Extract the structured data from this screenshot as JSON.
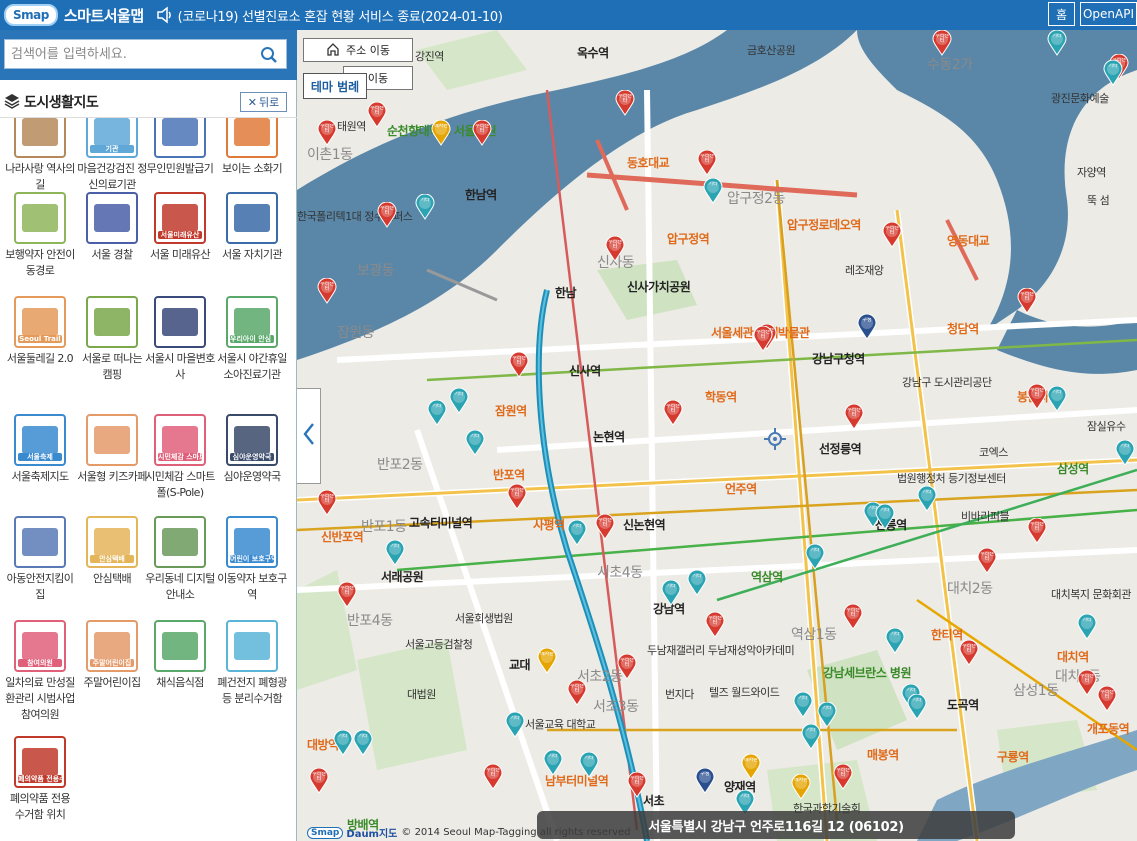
{
  "header": {
    "logo_badge": "Smap",
    "app_title": "스마트서울맵",
    "notice": "(코로나19) 선별진료소 혼잡 현황 서비스 종료(2024-01-10)",
    "btn_home": "홈",
    "btn_map": "지도",
    "btn_api": "OpenAPI"
  },
  "search": {
    "placeholder": "검색어를 입력하세요."
  },
  "panel": {
    "title": "도시생활지도",
    "back_label": "뒤로"
  },
  "items": [
    {
      "label": "나라사랑 역사의 길",
      "icon": "history-road-icon",
      "color": "#b5895a",
      "badge": ""
    },
    {
      "label": "마음건강검진 정신의료기관",
      "icon": "mental-health-icon",
      "color": "#5fa8d8",
      "badge": "기관"
    },
    {
      "label": "무인민원발급기",
      "icon": "kiosk-icon",
      "color": "#4a74b5",
      "badge": ""
    },
    {
      "label": "보이는 소화기",
      "icon": "extinguisher-icon",
      "color": "#e07a3a",
      "badge": ""
    },
    {
      "label": "보행약자 안전이동경로",
      "icon": "safe-route-icon",
      "color": "#8fb55a",
      "badge": ""
    },
    {
      "label": "서울 경찰",
      "icon": "police-icon",
      "color": "#4a5fa8",
      "badge": ""
    },
    {
      "label": "서울 미래유산",
      "icon": "future-heritage-icon",
      "color": "#c0392b",
      "badge": "서울미래유산"
    },
    {
      "label": "서울 자치기관",
      "icon": "government-office-icon",
      "color": "#3a6aa8",
      "badge": ""
    },
    {
      "label": "서울둘레길 2.0",
      "icon": "trail-icon",
      "color": "#e59a5a",
      "badge": "Seoul Trail"
    },
    {
      "label": "서울로 떠나는 캠핑",
      "icon": "camping-icon",
      "color": "#7aa84a",
      "badge": ""
    },
    {
      "label": "서울시 마을변호사",
      "icon": "lawyer-icon",
      "color": "#3a4a7a",
      "badge": ""
    },
    {
      "label": "서울시 야간휴일 소아진료기관",
      "icon": "pediatric-icon",
      "color": "#5aa86a",
      "badge": "우리아이 안심 의료기관"
    },
    {
      "label": "서울축제지도",
      "icon": "festival-icon",
      "color": "#3a8ad0",
      "badge": "서울축제"
    },
    {
      "label": "서울형 키즈카페",
      "icon": "kids-cafe-icon",
      "color": "#e59a6a",
      "badge": ""
    },
    {
      "label": "시민체감 스마트폴(S-Pole)",
      "icon": "smart-pole-icon",
      "color": "#e0607a",
      "badge": "시민체감 스마트폴"
    },
    {
      "label": "심야운영약국",
      "icon": "night-pharmacy-icon",
      "color": "#3a4a6a",
      "badge": "심야운영약국"
    },
    {
      "label": "아동안전지킴이집",
      "icon": "child-safety-icon",
      "color": "#5a7ab5",
      "badge": ""
    },
    {
      "label": "안심택배",
      "icon": "parcel-icon",
      "color": "#e5b55a",
      "badge": "안심택배"
    },
    {
      "label": "우리동네 디지털안내소",
      "icon": "digital-guide-icon",
      "color": "#6a9a5a",
      "badge": ""
    },
    {
      "label": "이동약자 보호구역",
      "icon": "mobility-zone-icon",
      "color": "#3a8ad0",
      "badge": "어린이 보호구역"
    },
    {
      "label": "일차의료 만성질환관리 시범사업 참여의원",
      "icon": "clinic-icon",
      "color": "#e0607a",
      "badge": "참여의원"
    },
    {
      "label": "주말어린이집",
      "icon": "weekend-daycare-icon",
      "color": "#e59a6a",
      "badge": "주말어린이집"
    },
    {
      "label": "채식음식점",
      "icon": "vegetarian-icon",
      "color": "#5aa86a",
      "badge": ""
    },
    {
      "label": "폐건전지 폐형광등 분리수거함",
      "icon": "battery-recycle-icon",
      "color": "#5ab5d8",
      "badge": ""
    },
    {
      "label": "폐의약품 전용 수거함 위치",
      "icon": "medicine-disposal-icon",
      "color": "#c0392b",
      "badge": "폐의약품 전용수거함"
    }
  ],
  "map": {
    "btn_address_move": "주소 이동",
    "btn_theme": "테마 범례",
    "btn_behind": "이동",
    "address": "서울특별시 강남구 언주로116길 12 (06102)",
    "copyright": "© 2014 Seoul Map-Tagging all rights reserved",
    "copyright_logo": "Smap",
    "daum_logo": "Daum지도",
    "pin_label_red": "우리센터",
    "pin_label_teal": "기타",
    "pin_label_yellow": "메자판",
    "pin_label_navy": "구청",
    "places": [
      {
        "t": "강진역",
        "c": "s"
      },
      {
        "t": "옥수역",
        "c": ""
      },
      {
        "t": "금호산공원",
        "c": "s"
      },
      {
        "t": "수동2가",
        "c": "gr"
      },
      {
        "t": "광진문화예술",
        "c": "s"
      },
      {
        "t": "태원역",
        "c": "s"
      },
      {
        "t": "순천향대학교 서울병원",
        "c": "g"
      },
      {
        "t": "한남역",
        "c": ""
      },
      {
        "t": "동호대교",
        "c": "o"
      },
      {
        "t": "압구정2동",
        "c": "gr"
      },
      {
        "t": "자양역",
        "c": "s"
      },
      {
        "t": "뚝 섬",
        "c": "s"
      },
      {
        "t": "한국폴리텍1대 정수캠퍼스",
        "c": "s"
      },
      {
        "t": "압구정로데오역",
        "c": "o"
      },
      {
        "t": "압구정역",
        "c": "o"
      },
      {
        "t": "영동대교",
        "c": "o"
      },
      {
        "t": "레조재앙",
        "c": "s"
      },
      {
        "t": "신사가치공원",
        "c": ""
      },
      {
        "t": "한남",
        "c": ""
      },
      {
        "t": "청담역",
        "c": "o"
      },
      {
        "t": "서울세관 관세박물관",
        "c": "o"
      },
      {
        "t": "강남구청역",
        "c": ""
      },
      {
        "t": "신사역",
        "c": ""
      },
      {
        "t": "학동역",
        "c": "o"
      },
      {
        "t": "강남구 도시관리공단",
        "c": "s"
      },
      {
        "t": "봉은사역",
        "c": "o"
      },
      {
        "t": "잠실유수",
        "c": "s"
      },
      {
        "t": "잠원역",
        "c": "o"
      },
      {
        "t": "논현역",
        "c": ""
      },
      {
        "t": "선정릉역",
        "c": ""
      },
      {
        "t": "코엑스",
        "c": "s"
      },
      {
        "t": "반포2동",
        "c": "gr"
      },
      {
        "t": "반포역",
        "c": "o"
      },
      {
        "t": "법원행정처 등기정보센터",
        "c": "s"
      },
      {
        "t": "삼성역",
        "c": "g"
      },
      {
        "t": "언주역",
        "c": "o"
      },
      {
        "t": "비바리퍼블",
        "c": "s"
      },
      {
        "t": "고속터미널역",
        "c": ""
      },
      {
        "t": "사평역",
        "c": "o"
      },
      {
        "t": "신논현역",
        "c": ""
      },
      {
        "t": "선릉역",
        "c": ""
      },
      {
        "t": "신반포역",
        "c": "o"
      },
      {
        "t": "서래공원",
        "c": ""
      },
      {
        "t": "역삼역",
        "c": "g"
      },
      {
        "t": "대치2동",
        "c": "gr"
      },
      {
        "t": "강남역",
        "c": ""
      },
      {
        "t": "서울회생법원",
        "c": "s"
      },
      {
        "t": "대치복지 문화회관",
        "c": "s"
      },
      {
        "t": "서울고등검찰청",
        "c": "s"
      },
      {
        "t": "한티역",
        "c": "o"
      },
      {
        "t": "두남재갤러리 두남재성악아카데미",
        "c": "s"
      },
      {
        "t": "대치역",
        "c": "o"
      },
      {
        "t": "대법원",
        "c": "s"
      },
      {
        "t": "교대",
        "c": ""
      },
      {
        "t": "강남세브란스 병원",
        "c": "g"
      },
      {
        "t": "번지다",
        "c": "s"
      },
      {
        "t": "텔즈 월드와이드",
        "c": "s"
      },
      {
        "t": "도곡역",
        "c": ""
      },
      {
        "t": "서울교육 대학교",
        "c": "s"
      },
      {
        "t": "개포동역",
        "c": "o"
      },
      {
        "t": "매봉역",
        "c": "o"
      },
      {
        "t": "대방역",
        "c": "o"
      },
      {
        "t": "구룡역",
        "c": "o"
      },
      {
        "t": "남부터미널역",
        "c": "o"
      },
      {
        "t": "양재역",
        "c": ""
      },
      {
        "t": "한국과학기술회",
        "c": "s"
      },
      {
        "t": "방배역",
        "c": "g"
      },
      {
        "t": "서초",
        "c": ""
      },
      {
        "t": "반포4동",
        "c": "gr"
      },
      {
        "t": "서초2동",
        "c": "gr"
      },
      {
        "t": "역삼1동",
        "c": "gr"
      },
      {
        "t": "대치1동",
        "c": "gr"
      },
      {
        "t": "반포1동",
        "c": "gr"
      },
      {
        "t": "이촌1동",
        "c": "gr"
      },
      {
        "t": "보광동",
        "c": "gr"
      },
      {
        "t": "신사동",
        "c": "gr"
      },
      {
        "t": "잠원동",
        "c": "gr"
      },
      {
        "t": "서초4동",
        "c": "gr"
      },
      {
        "t": "서초3동",
        "c": "gr"
      },
      {
        "t": "삼성1동",
        "c": "gr"
      }
    ]
  }
}
